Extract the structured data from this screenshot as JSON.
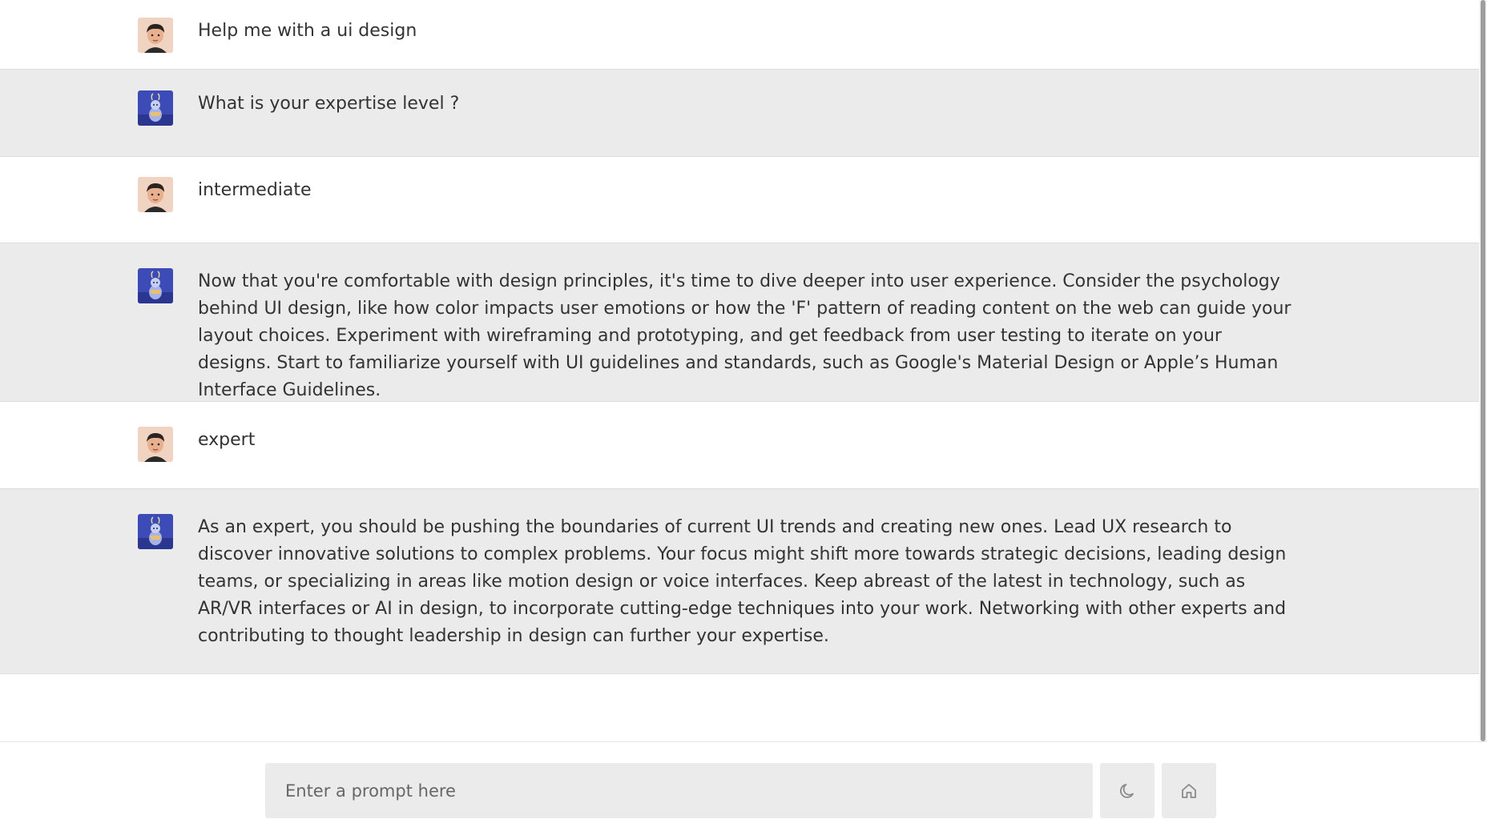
{
  "messages": [
    {
      "role": "user",
      "avatar": "user-avatar-icon",
      "text": "Help me with a ui design"
    },
    {
      "role": "bot",
      "avatar": "bot-avatar-icon",
      "text": "What is your expertise level ?"
    },
    {
      "role": "user",
      "avatar": "user-avatar-icon",
      "text": "intermediate"
    },
    {
      "role": "bot",
      "avatar": "bot-avatar-icon",
      "text": "Now that you're comfortable with design principles, it's time to dive deeper into user experience. Consider the psychology behind UI design, like how color impacts user emotions or how the 'F' pattern of reading content on the web can guide your layout choices. Experiment with wireframing and prototyping, and get feedback from user testing to iterate on your designs. Start to familiarize yourself with UI guidelines and standards, such as Google's Material Design or Apple’s Human Interface Guidelines."
    },
    {
      "role": "user",
      "avatar": "user-avatar-icon",
      "text": "expert"
    },
    {
      "role": "bot",
      "avatar": "bot-avatar-icon",
      "text": "As an expert, you should be pushing the boundaries of current UI trends and creating new ones. Lead UX research to discover innovative solutions to complex problems. Your focus might shift more towards strategic decisions, leading design teams, or specializing in areas like motion design or voice interfaces. Keep abreast of the latest in technology, such as AR/VR interfaces or AI in design, to incorporate cutting-edge techniques into your work. Networking with other experts and contributing to thought leadership in design can further your expertise."
    }
  ],
  "input": {
    "value": "",
    "placeholder": "Enter a prompt here"
  },
  "buttons": {
    "theme_icon": "moon-icon",
    "home_icon": "home-icon"
  },
  "colors": {
    "user_row_bg": "#ffffff",
    "bot_row_bg": "#ebebeb",
    "text": "#333333",
    "input_bg": "#ebebeb",
    "icon": "#8a8a8a"
  }
}
